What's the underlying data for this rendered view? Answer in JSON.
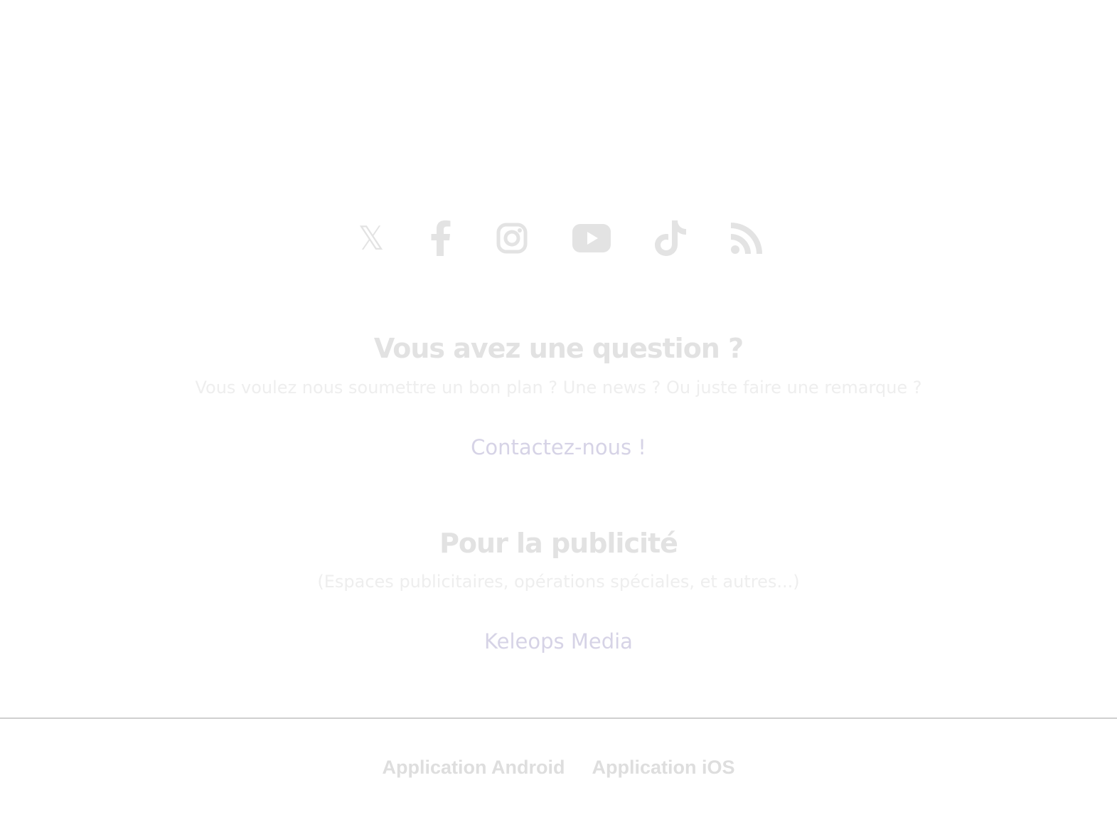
{
  "social": {
    "items": [
      {
        "icon": "x-twitter-icon",
        "glyph": "𝕏"
      },
      {
        "icon": "facebook-icon"
      },
      {
        "icon": "instagram-icon"
      },
      {
        "icon": "youtube-icon"
      },
      {
        "icon": "tiktok-icon"
      },
      {
        "icon": "rss-icon"
      }
    ],
    "color": "#e3e3e3"
  },
  "contact": {
    "title": "Vous avez une question ?",
    "subtitle": "Vous voulez nous soumettre un bon plan ? Une news ? Ou juste faire une remarque ?",
    "link_label": "Contactez-nous !"
  },
  "advertising": {
    "title": "Pour la publicité",
    "subtitle": "(Espaces publicitaires, opérations spéciales, et autres...)",
    "link_label": "Keleops Media"
  },
  "apps": {
    "android_label": "Application Android",
    "ios_label": "Application iOS"
  },
  "colors": {
    "link": "#d6d3e6",
    "heading": "#e2e2e2",
    "icon": "#e3e3e3"
  }
}
